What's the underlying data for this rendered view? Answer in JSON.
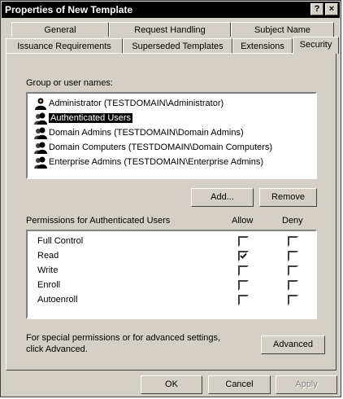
{
  "window": {
    "title": "Properties of New Template"
  },
  "title_buttons": {
    "help": "?",
    "close": "×"
  },
  "tabs_row1": [
    "General",
    "Request Handling",
    "Subject Name"
  ],
  "tabs_row2": [
    "Issuance Requirements",
    "Superseded Templates",
    "Extensions",
    "Security"
  ],
  "active_tab": "Security",
  "group_label": "Group or user names:",
  "users": [
    {
      "name": "Administrator (TESTDOMAIN\\Administrator)",
      "icon": "user-icon",
      "selected": false
    },
    {
      "name": "Authenticated Users",
      "icon": "group-icon",
      "selected": true
    },
    {
      "name": "Domain Admins (TESTDOMAIN\\Domain Admins)",
      "icon": "group-icon",
      "selected": false
    },
    {
      "name": "Domain Computers (TESTDOMAIN\\Domain Computers)",
      "icon": "group-icon",
      "selected": false
    },
    {
      "name": "Enterprise Admins (TESTDOMAIN\\Enterprise Admins)",
      "icon": "group-icon",
      "selected": false
    }
  ],
  "buttons": {
    "add": "Add...",
    "remove": "Remove",
    "advanced": "Advanced",
    "ok": "OK",
    "cancel": "Cancel",
    "apply": "Apply"
  },
  "permissions_label": "Permissions for Authenticated Users",
  "allow_header": "Allow",
  "deny_header": "Deny",
  "permissions": [
    {
      "name": "Full Control",
      "allow": false,
      "deny": false
    },
    {
      "name": "Read",
      "allow": true,
      "deny": false
    },
    {
      "name": "Write",
      "allow": false,
      "deny": false
    },
    {
      "name": "Enroll",
      "allow": false,
      "deny": false
    },
    {
      "name": "Autoenroll",
      "allow": false,
      "deny": false
    }
  ],
  "advanced_note": "For special permissions or for advanced settings, click Advanced."
}
